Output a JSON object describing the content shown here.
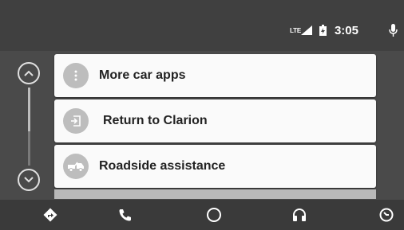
{
  "status": {
    "network": "LTE",
    "time": "3:05"
  },
  "list": {
    "items": [
      {
        "label": "More car apps",
        "icon": "more-vert-icon"
      },
      {
        "label": "Return to Clarion",
        "icon": "exit-icon"
      },
      {
        "label": "Roadside assistance",
        "icon": "tow-truck-icon"
      }
    ]
  },
  "navbar": {
    "items": [
      "navigation-icon",
      "phone-icon",
      "home-icon",
      "audio-icon",
      "recent-icon"
    ]
  },
  "colors": {
    "background": "#4a4a4a",
    "card": "#fafafa",
    "icon_circle": "#bdbdbd",
    "navbar": "#3a3a3a"
  }
}
